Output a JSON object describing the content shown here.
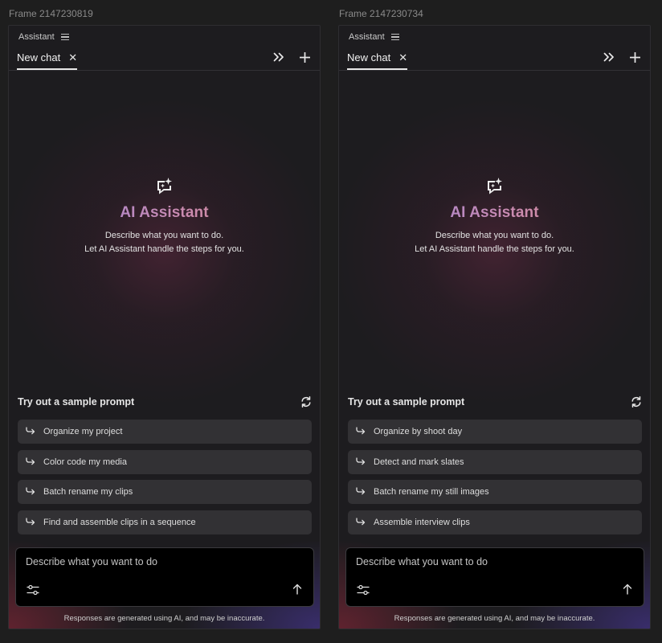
{
  "frames": [
    {
      "frame_label": "Frame 2147230819",
      "panel_title": "Assistant",
      "tab_label": "New chat",
      "tab_close": "✕",
      "hero": {
        "title": "AI Assistant",
        "line1": "Describe what you want to do.",
        "line2": "Let AI Assistant handle the steps for you."
      },
      "sample_title": "Try out a sample prompt",
      "prompts": [
        {
          "label": "Organize my project"
        },
        {
          "label": "Color code my media"
        },
        {
          "label": "Batch rename my clips"
        },
        {
          "label": "Find and assemble clips in a sequence"
        }
      ],
      "input_placeholder": "Describe what you want to do",
      "disclaimer": "Responses are generated using AI, and may be inaccurate."
    },
    {
      "frame_label": "Frame 2147230734",
      "panel_title": "Assistant",
      "tab_label": "New chat",
      "tab_close": "✕",
      "hero": {
        "title": "AI Assistant",
        "line1": "Describe what you want to do.",
        "line2": "Let AI Assistant handle the steps for you."
      },
      "sample_title": "Try out a sample prompt",
      "prompts": [
        {
          "label": "Organize by shoot day"
        },
        {
          "label": "Detect and mark slates"
        },
        {
          "label": "Batch rename my still images"
        },
        {
          "label": "Assemble interview clips"
        }
      ],
      "input_placeholder": "Describe what you want to do",
      "disclaimer": "Responses are generated using AI, and may be inaccurate."
    }
  ],
  "icons": {
    "menu": "hamburger-menu-icon",
    "collapse": "double-chevron-right-icon",
    "new_chat": "plus-icon",
    "assistant": "chat-sparkle-icon",
    "refresh": "refresh-icon",
    "prompt_arrow": "arrow-return-right-icon",
    "settings": "sliders-icon",
    "send": "arrow-up-icon"
  },
  "colors": {
    "background": "#1e1e1e",
    "panel": "#1d1c1f",
    "prompt_chip": "#323134",
    "title_gradient_start": "#9a86e6",
    "title_gradient_end": "#e48f8f"
  }
}
